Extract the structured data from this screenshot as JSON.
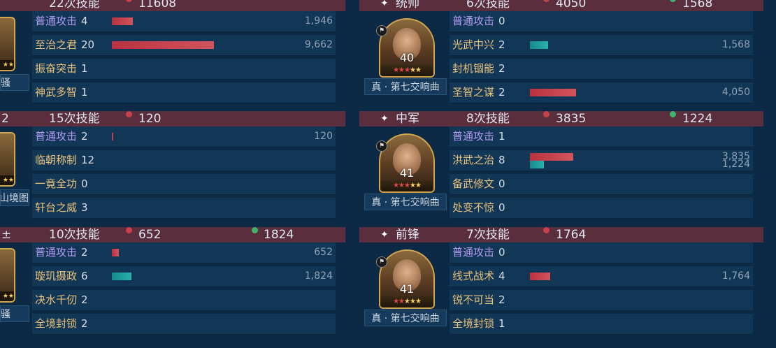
{
  "colors": {
    "background": "#0c2a45",
    "header": "#5a2e3c",
    "row": "#123656",
    "basic_attack": "#b39cf0",
    "skill_name": "#e9c27a",
    "damage_bar": "#c8404a",
    "heal_bar": "#1a9c9a",
    "dot_red": "#c8404a",
    "dot_green": "#3eb56a"
  },
  "left_panels": [
    {
      "header": {
        "prefix": "",
        "skill_count": "22次技能",
        "damage": "11608",
        "heal": ""
      },
      "partial_book": "骚",
      "skills": [
        {
          "name": "普通攻击",
          "count": "4",
          "basic": true,
          "damage_label": "1,946",
          "damage_fraction": 0.087,
          "heal_label": "",
          "heal_fraction": 0
        },
        {
          "name": "至治之君",
          "count": "20",
          "basic": false,
          "damage_label": "9,662",
          "damage_fraction": 0.43,
          "heal_label": "",
          "heal_fraction": 0
        },
        {
          "name": "振奋突击",
          "count": "1",
          "basic": false,
          "damage_label": "",
          "damage_fraction": 0,
          "heal_label": "",
          "heal_fraction": 0
        },
        {
          "name": "神武多智",
          "count": "1",
          "basic": false,
          "damage_label": "",
          "damage_fraction": 0,
          "heal_label": "",
          "heal_fraction": 0
        }
      ]
    },
    {
      "header": {
        "prefix": "2",
        "skill_count": "15次技能",
        "damage": "120",
        "heal": ""
      },
      "partial_book": "山境图",
      "skills": [
        {
          "name": "普通攻击",
          "count": "2",
          "basic": true,
          "damage_label": "120",
          "damage_fraction": 0.005,
          "heal_label": "",
          "heal_fraction": 0
        },
        {
          "name": "临朝称制",
          "count": "12",
          "basic": false,
          "damage_label": "",
          "damage_fraction": 0,
          "heal_label": "",
          "heal_fraction": 0
        },
        {
          "name": "一竟全功",
          "count": "0",
          "basic": false,
          "damage_label": "",
          "damage_fraction": 0,
          "heal_label": "",
          "heal_fraction": 0
        },
        {
          "name": "轩台之威",
          "count": "3",
          "basic": false,
          "damage_label": "",
          "damage_fraction": 0,
          "heal_label": "",
          "heal_fraction": 0
        }
      ]
    },
    {
      "header": {
        "prefix": "±",
        "skill_count": "10次技能",
        "damage": "652",
        "heal": "1824"
      },
      "partial_book": "骚",
      "skills": [
        {
          "name": "普通攻击",
          "count": "2",
          "basic": true,
          "damage_label": "652",
          "damage_fraction": 0.03,
          "heal_label": "",
          "heal_fraction": 0
        },
        {
          "name": "璇玑摄政",
          "count": "6",
          "basic": false,
          "damage_label": "",
          "damage_fraction": 0,
          "heal_label": "1,824",
          "heal_fraction": 0.082
        },
        {
          "name": "决水千仞",
          "count": "2",
          "basic": false,
          "damage_label": "",
          "damage_fraction": 0,
          "heal_label": "",
          "heal_fraction": 0
        },
        {
          "name": "全境封锁",
          "count": "2",
          "basic": false,
          "damage_label": "",
          "damage_fraction": 0,
          "heal_label": "",
          "heal_fraction": 0
        }
      ]
    }
  ],
  "right_panels": [
    {
      "header": {
        "role": "统帅",
        "skill_count": "6次技能",
        "damage": "4050",
        "heal": "1568"
      },
      "portrait": {
        "level": "40",
        "red_stars": "★★★",
        "gold_stars": "★★"
      },
      "book": "真 · 第七交响曲",
      "skills": [
        {
          "name": "普通攻击",
          "count": "0",
          "basic": true,
          "damage_label": "",
          "damage_fraction": 0,
          "heal_label": "",
          "heal_fraction": 0
        },
        {
          "name": "光武中兴",
          "count": "2",
          "basic": false,
          "damage_label": "",
          "damage_fraction": 0,
          "heal_label": "1,568",
          "heal_fraction": 0.075
        },
        {
          "name": "封机锢能",
          "count": "2",
          "basic": false,
          "damage_label": "",
          "damage_fraction": 0,
          "heal_label": "",
          "heal_fraction": 0
        },
        {
          "name": "圣智之谋",
          "count": "2",
          "basic": false,
          "damage_label": "4,050",
          "damage_fraction": 0.193,
          "heal_label": "",
          "heal_fraction": 0
        }
      ]
    },
    {
      "header": {
        "role": "中军",
        "skill_count": "8次技能",
        "damage": "3835",
        "heal": "1224"
      },
      "portrait": {
        "level": "41",
        "red_stars": "★★★",
        "gold_stars": "★★"
      },
      "book": "真 · 第七交响曲",
      "skills": [
        {
          "name": "普通攻击",
          "count": "1",
          "basic": true,
          "damage_label": "",
          "damage_fraction": 0,
          "heal_label": "",
          "heal_fraction": 0
        },
        {
          "name": "洪武之治",
          "count": "8",
          "basic": false,
          "damage_label": "3,835",
          "damage_fraction": 0.183,
          "heal_label": "1,224",
          "heal_fraction": 0.058
        },
        {
          "name": "备武修文",
          "count": "0",
          "basic": false,
          "damage_label": "",
          "damage_fraction": 0,
          "heal_label": "",
          "heal_fraction": 0
        },
        {
          "name": "处变不惊",
          "count": "0",
          "basic": false,
          "damage_label": "",
          "damage_fraction": 0,
          "heal_label": "",
          "heal_fraction": 0
        }
      ]
    },
    {
      "header": {
        "role": "前锋",
        "skill_count": "7次技能",
        "damage": "1764",
        "heal": ""
      },
      "portrait": {
        "level": "41",
        "red_stars": "★★",
        "gold_stars": "★★★"
      },
      "book": "真 · 第七交响曲",
      "skills": [
        {
          "name": "普通攻击",
          "count": "0",
          "basic": true,
          "damage_label": "",
          "damage_fraction": 0,
          "heal_label": "",
          "heal_fraction": 0
        },
        {
          "name": "线式战术",
          "count": "4",
          "basic": false,
          "damage_label": "1,764",
          "damage_fraction": 0.084,
          "heal_label": "",
          "heal_fraction": 0
        },
        {
          "name": "锐不可当",
          "count": "2",
          "basic": false,
          "damage_label": "",
          "damage_fraction": 0,
          "heal_label": "",
          "heal_fraction": 0
        },
        {
          "name": "全境封锁",
          "count": "1",
          "basic": false,
          "damage_label": "",
          "damage_fraction": 0,
          "heal_label": "",
          "heal_fraction": 0
        }
      ]
    }
  ]
}
